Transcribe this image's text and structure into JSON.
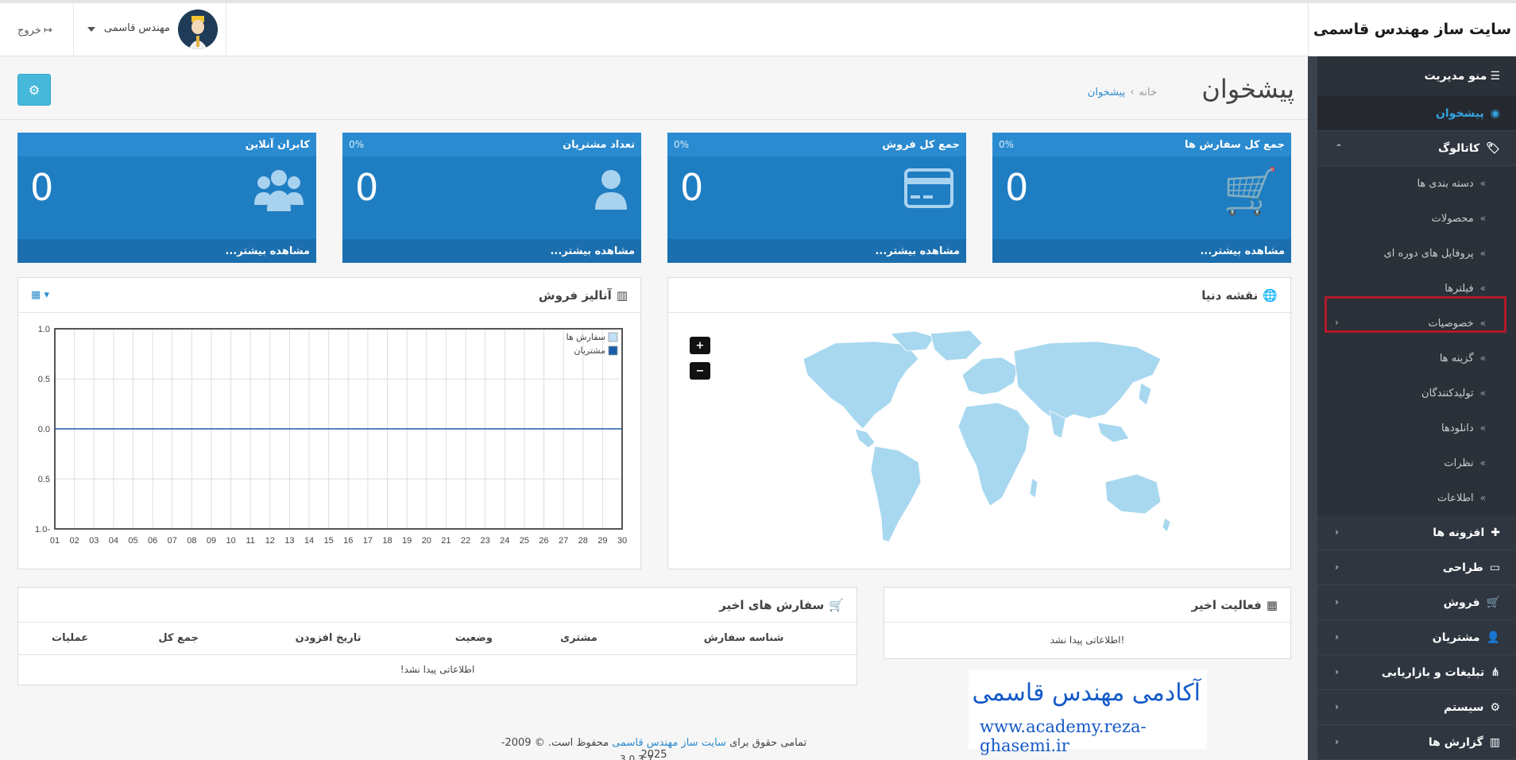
{
  "header": {
    "brand": "سایت ساز مهندس قاسمی",
    "user_name": "مهندس قاسمی",
    "logout": "خروج"
  },
  "sidebar": {
    "title": "منو مدیریت",
    "dashboard": "پیشخوان",
    "catalog": "کاتالوگ",
    "catalog_items": [
      "دسته بندی ها",
      "محصولات",
      "پروفایل های دوره ای",
      "فیلترها",
      "خصوصیات",
      "گزینه ها",
      "تولیدکنندگان",
      "دانلودها",
      "نظرات",
      "اطلاعات"
    ],
    "extensions": "افزونه ها",
    "design": "طراحی",
    "sales": "فروش",
    "customers": "مشتریان",
    "marketing": "تبلیغات و بازاریابی",
    "system": "سیستم",
    "reports": "گزارش ها"
  },
  "page": {
    "title": "پیشخوان",
    "breadcrumb_home": "خانه",
    "breadcrumb_current": "پیشخوان"
  },
  "tiles": [
    {
      "title": "جمع کل سفارش ها",
      "percent": "0%",
      "value": "0",
      "more": "مشاهده بیشتر..."
    },
    {
      "title": "جمع کل فروش",
      "percent": "0%",
      "value": "0",
      "more": "مشاهده بیشتر..."
    },
    {
      "title": "تعداد مشتریان",
      "percent": "0%",
      "value": "0",
      "more": "مشاهده بیشتر..."
    },
    {
      "title": "کابران آنلاین",
      "value": "0",
      "more": "مشاهده بیشتر..."
    }
  ],
  "map_panel": {
    "title": "نقشه دنیا",
    "zoom_in": "+",
    "zoom_out": "−"
  },
  "sales_panel": {
    "title": "آنالیز فروش"
  },
  "chart_data": {
    "type": "line",
    "x": [
      "01",
      "02",
      "03",
      "04",
      "05",
      "06",
      "07",
      "08",
      "09",
      "10",
      "11",
      "12",
      "13",
      "14",
      "15",
      "16",
      "17",
      "18",
      "19",
      "20",
      "21",
      "22",
      "23",
      "24",
      "25",
      "26",
      "27",
      "28",
      "29",
      "30"
    ],
    "y_ticks": [
      "1.0",
      "0.5",
      "0.0",
      "0.5",
      "1.0-"
    ],
    "ylim": [
      -1,
      1
    ],
    "series": [
      {
        "name": "سفارش ها",
        "color": "#bfe0f5",
        "values": [
          0,
          0,
          0,
          0,
          0,
          0,
          0,
          0,
          0,
          0,
          0,
          0,
          0,
          0,
          0,
          0,
          0,
          0,
          0,
          0,
          0,
          0,
          0,
          0,
          0,
          0,
          0,
          0,
          0,
          0
        ]
      },
      {
        "name": "مشتریان",
        "color": "#1a5fa8",
        "values": [
          0,
          0,
          0,
          0,
          0,
          0,
          0,
          0,
          0,
          0,
          0,
          0,
          0,
          0,
          0,
          0,
          0,
          0,
          0,
          0,
          0,
          0,
          0,
          0,
          0,
          0,
          0,
          0,
          0,
          0
        ]
      }
    ]
  },
  "activity": {
    "title": "فعالیت اخیر",
    "empty": "اطلاعاتی پیدا نشد!"
  },
  "orders": {
    "title": "سفارش های اخیر",
    "columns": [
      "شناسه سفارش",
      "مشتری",
      "وضعیت",
      "تاریخ افزودن",
      "جمع کل",
      "عملیات"
    ],
    "empty": "اطلاعاتی پیدا نشد!"
  },
  "watermark": {
    "title": "آکادمی مهندس قاسمی",
    "url": "www.academy.reza-ghasemi.ir"
  },
  "footer": {
    "prefix": "تمامی حقوق برای",
    "link": "سایت ساز مهندس قاسمی",
    "suffix": "محفوظ است. © 2009-2025",
    "version": "3.0.3.7"
  },
  "colors": {
    "accent": "#1f7dc2",
    "sidebar": "#2f3640",
    "highlight": "#b21a2b"
  }
}
